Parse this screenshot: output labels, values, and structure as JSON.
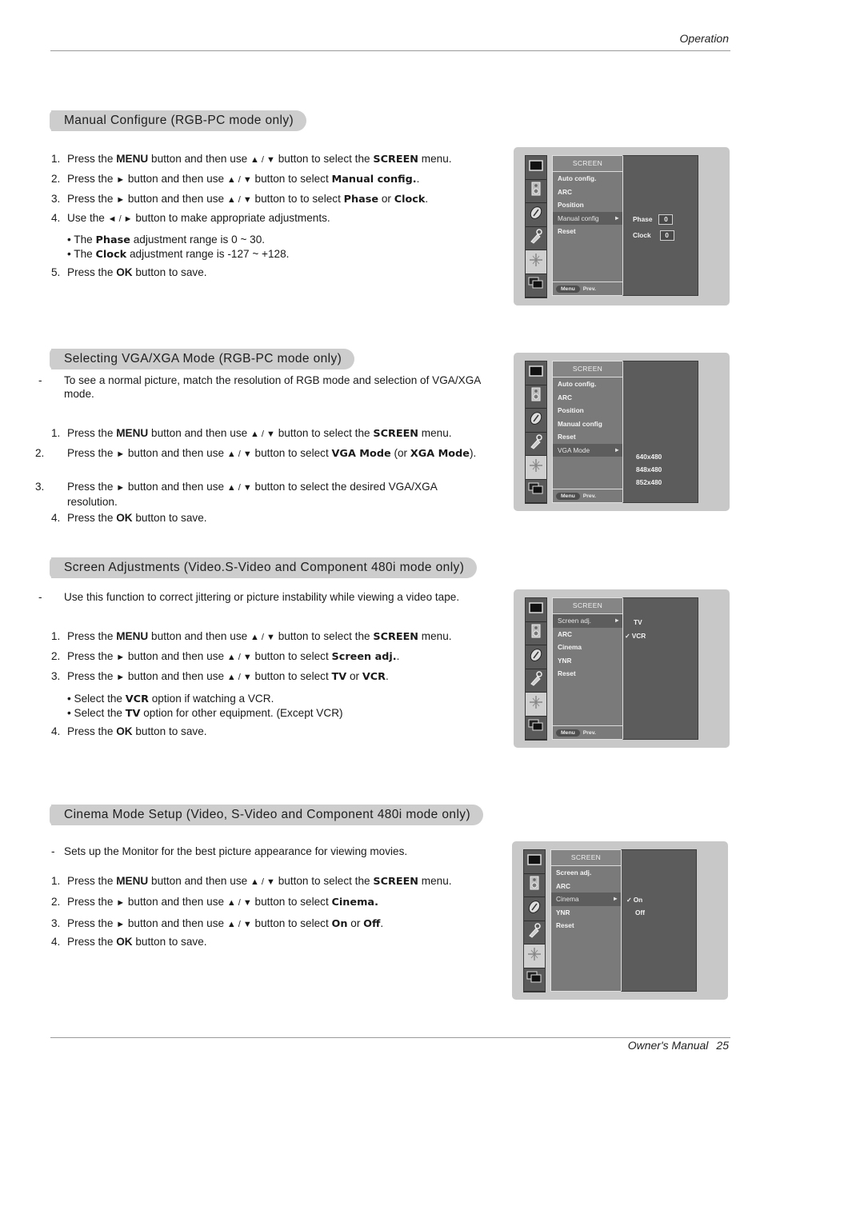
{
  "header": {
    "section": "Operation"
  },
  "footer": {
    "manual": "Owner's Manual",
    "page": "25"
  },
  "sections": [
    {
      "title": "Manual Configure (RGB-PC mode only)",
      "steps": [
        {
          "n": "1.",
          "pre": "Press the ",
          "b1": "MENU",
          "mid": " button and then use ",
          "arrows": "▲ / ▼",
          "mid2": " button to select the ",
          "kw": "SCREEN",
          "post": " menu."
        },
        {
          "n": "2.",
          "pre": "Press the ",
          "arrow1": "►",
          "mid": " button and then use ",
          "arrows": "▲ / ▼",
          "mid2": " button to select ",
          "kw": "Manual config.",
          "post": "."
        },
        {
          "n": "3.",
          "pre": "Press the ",
          "arrow1": "►",
          "mid": " button and then use ",
          "arrows": "▲ / ▼",
          "mid2": " button to to select ",
          "kw": "Phase",
          "or": " or ",
          "kw2": "Clock",
          "post": "."
        },
        {
          "n": "4.",
          "pre": "Use the ",
          "arrows": "◄ / ►",
          "post": " button to make appropriate adjustments."
        },
        {
          "n": "5.",
          "pre": "Press the ",
          "b1": "OK",
          "post": " button to save."
        }
      ],
      "bullets": [
        {
          "pre": "• The ",
          "kw": "Phase",
          "post": "  adjustment range is 0 ~ 30."
        },
        {
          "pre": "• The ",
          "kw": "Clock",
          "post": " adjustment range is -127 ~ +128."
        }
      ],
      "osd": {
        "title": "SCREEN",
        "items": [
          "Auto config.",
          "ARC",
          "Position",
          "Manual config",
          "Reset"
        ],
        "selected": "Manual config",
        "submenu": [
          {
            "label": "Phase",
            "value": "0"
          },
          {
            "label": "Clock",
            "value": "0"
          }
        ],
        "footer_button": "Menu",
        "footer_label": "Prev."
      }
    },
    {
      "title": "Selecting VGA/XGA Mode (RGB-PC mode only)",
      "intro": "To see a normal picture, match the resolution of RGB mode and selection of VGA/XGA mode.",
      "steps": [
        {
          "n": "1.",
          "pre": "Press the ",
          "b1": "MENU",
          "mid": " button and then use ",
          "arrows": "▲ / ▼",
          "mid2": " button to select the ",
          "kw": "SCREEN",
          "post": " menu."
        },
        {
          "n": "2.",
          "pre": "Press the ",
          "arrow1": "►",
          "mid": " button and then use ",
          "arrows": "▲ / ▼",
          "mid2": "  button to select ",
          "kw": "VGA Mode",
          "or": " (or ",
          "kw2": "XGA Mode",
          "post": ")."
        },
        {
          "n": "3.",
          "pre": "Press the ",
          "arrow1": "►",
          "mid": " button and then use ",
          "arrows": "▲ / ▼",
          "mid2": " button to select the desired VGA/XGA resolution.",
          "post": ""
        },
        {
          "n": "4.",
          "pre": "Press the ",
          "b1": "OK",
          "post": " button to save."
        }
      ],
      "osd": {
        "title": "SCREEN",
        "items": [
          "Auto config.",
          "ARC",
          "Position",
          "Manual config",
          "Reset",
          "VGA Mode"
        ],
        "selected": "VGA Mode",
        "submenu": [
          {
            "label": "640x480"
          },
          {
            "label": "848x480"
          },
          {
            "label": "852x480"
          }
        ],
        "footer_button": "Menu",
        "footer_label": "Prev."
      }
    },
    {
      "title": "Screen Adjustments (Video.S-Video and Component 480i mode only)",
      "intro": "Use this function to correct jittering or picture instability while viewing a video tape.",
      "steps": [
        {
          "n": "1.",
          "pre": "Press the ",
          "b1": "MENU",
          "mid": " button and then use ",
          "arrows": "▲ / ▼",
          "mid2": " button to select the ",
          "kw": "SCREEN",
          "post": " menu."
        },
        {
          "n": "2.",
          "pre": "Press the ",
          "arrow1": "►",
          "mid": " button and then use ",
          "arrows": "▲ / ▼",
          "mid2": "  button to select ",
          "kw": "Screen adj.",
          "post": "."
        },
        {
          "n": "3.",
          "pre": "Press the ",
          "arrow1": "►",
          "mid": " button and then use ",
          "arrows": "▲ / ▼",
          "mid2": " button to select ",
          "kw": "TV",
          "or": " or ",
          "kw2": "VCR",
          "post": "."
        },
        {
          "n": "4.",
          "pre": "Press the ",
          "b1": "OK",
          "post": " button to save."
        }
      ],
      "bullets": [
        {
          "pre": "• Select the ",
          "kw": "VCR",
          "post": " option if watching a VCR."
        },
        {
          "pre": "• Select the ",
          "kw": "TV",
          "post": " option for other equipment. (Except VCR)"
        }
      ],
      "osd": {
        "title": "SCREEN",
        "items": [
          "Screen adj.",
          "ARC",
          "Cinema",
          "YNR",
          "Reset"
        ],
        "selected": "Screen adj.",
        "submenu": [
          {
            "label": "TV",
            "checked": false
          },
          {
            "label": "VCR",
            "checked": true
          }
        ],
        "footer_button": "Menu",
        "footer_label": "Prev."
      }
    },
    {
      "title": "Cinema Mode Setup (Video, S-Video and Component 480i mode only)",
      "intro": "Sets up the Monitor for the best picture appearance for viewing movies.",
      "steps": [
        {
          "n": "1.",
          "pre": "Press the ",
          "b1": "MENU",
          "mid": " button and then use ",
          "arrows": "▲ / ▼",
          "mid2": " button to select the ",
          "kw": "SCREEN",
          "post": " menu."
        },
        {
          "n": "2.",
          "pre": "Press the ",
          "arrow1": "►",
          "mid": "  button and then use ",
          "arrows": "▲ / ▼",
          "mid2": " button to select ",
          "kw": "Cinema.",
          "post": "."
        },
        {
          "n": "3.",
          "pre": "Press the ",
          "arrow1": "►",
          "mid": "  button and then use ",
          "arrows": "▲ / ▼",
          "mid2": " button to select ",
          "kw": "On",
          "or": " or ",
          "kw2": "Off",
          "post": "."
        },
        {
          "n": "4.",
          "pre": "Press the ",
          "b1": "OK",
          "post": " button to save."
        }
      ],
      "osd": {
        "title": "SCREEN",
        "items": [
          "Screen adj.",
          "ARC",
          "Cinema",
          "YNR",
          "Reset"
        ],
        "selected": "Cinema",
        "submenu": [
          {
            "label": "On",
            "checked": true
          },
          {
            "label": "Off",
            "checked": false
          }
        ]
      }
    }
  ],
  "icons": [
    "picture-icon",
    "speaker-icon",
    "clock-icon",
    "key-icon",
    "screen-adjust-icon",
    "pip-icon"
  ],
  "glyphs": {
    "check": "✓",
    "sel_arrow": "►"
  }
}
